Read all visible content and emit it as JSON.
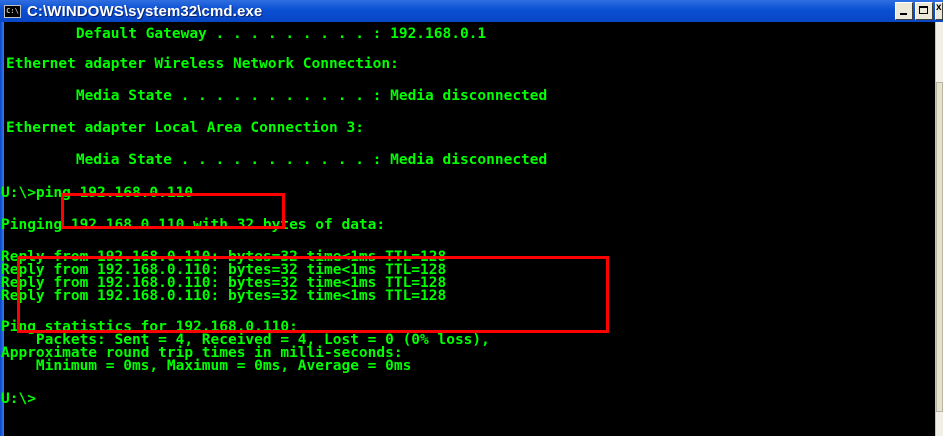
{
  "window": {
    "title": "C:\\WINDOWS\\system32\\cmd.exe",
    "icon": "C:\\"
  },
  "console": {
    "lines": [
      "        Default Gateway . . . . . . . . . : 192.168.0.1",
      "Ethernet adapter Wireless Network Connection:",
      "        Media State . . . . . . . . . . . : Media disconnected",
      "Ethernet adapter Local Area Connection 3:",
      "        Media State . . . . . . . . . . . : Media disconnected",
      "U:\\>ping 192.168.0.110",
      "Pinging 192.168.0.110 with 32 bytes of data:",
      "Reply from 192.168.0.110: bytes=32 time<1ms TTL=128",
      "Reply from 192.168.0.110: bytes=32 time<1ms TTL=128",
      "Reply from 192.168.0.110: bytes=32 time<1ms TTL=128",
      "Reply from 192.168.0.110: bytes=32 time<1ms TTL=128",
      "Ping statistics for 192.168.0.110:",
      "    Packets: Sent = 4, Received = 4, Lost = 0 (0% loss),",
      "Approximate round trip times in milli-seconds:",
      "    Minimum = 0ms, Maximum = 0ms, Average = 0ms",
      "U:\\>"
    ]
  },
  "colors": {
    "console_text": "#00ff00",
    "console_bg": "#000000",
    "highlight": "#ff0000",
    "titlebar": "#0a4fd3"
  }
}
